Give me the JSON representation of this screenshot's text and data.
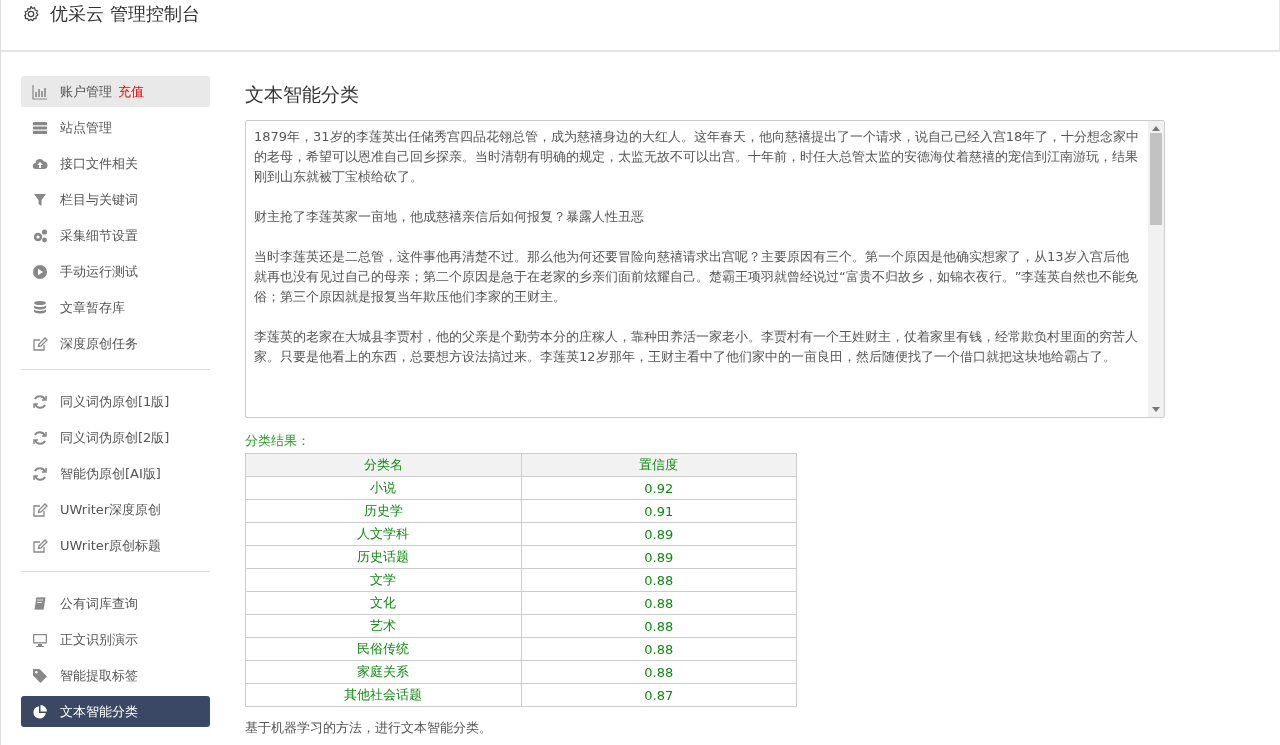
{
  "header": {
    "title": "优采云 管理控制台"
  },
  "sidebar": {
    "groups": [
      {
        "items": [
          {
            "label": "账户管理",
            "badge": "充值",
            "kind": "bars",
            "selected": false,
            "hover": true
          },
          {
            "label": "站点管理",
            "kind": "server",
            "selected": false,
            "hover": false
          },
          {
            "label": "接口文件相关",
            "kind": "cloud",
            "selected": false,
            "hover": false
          },
          {
            "label": "栏目与关键词",
            "kind": "filter",
            "selected": false,
            "hover": false
          },
          {
            "label": "采集细节设置",
            "kind": "gears",
            "selected": false,
            "hover": false
          },
          {
            "label": "手动运行测试",
            "kind": "play",
            "selected": false,
            "hover": false
          },
          {
            "label": "文章暂存库",
            "kind": "database",
            "selected": false,
            "hover": false
          },
          {
            "label": "深度原创任务",
            "kind": "edit",
            "selected": false,
            "hover": false
          }
        ]
      },
      {
        "items": [
          {
            "label": "同义词伪原创[1版]",
            "kind": "refresh",
            "selected": false,
            "hover": false
          },
          {
            "label": "同义词伪原创[2版]",
            "kind": "refresh",
            "selected": false,
            "hover": false
          },
          {
            "label": "智能伪原创[AI版]",
            "kind": "refresh",
            "selected": false,
            "hover": false
          },
          {
            "label": "UWriter深度原创",
            "kind": "edit",
            "selected": false,
            "hover": false
          },
          {
            "label": "UWriter原创标题",
            "kind": "edit",
            "selected": false,
            "hover": false
          }
        ]
      },
      {
        "items": [
          {
            "label": "公有词库查询",
            "kind": "book",
            "selected": false,
            "hover": false
          },
          {
            "label": "正文识别演示",
            "kind": "monitor",
            "selected": false,
            "hover": false
          },
          {
            "label": "智能提取标签",
            "kind": "tag",
            "selected": false,
            "hover": false
          },
          {
            "label": "文本智能分类",
            "kind": "pie",
            "selected": true,
            "hover": false
          }
        ]
      }
    ]
  },
  "main": {
    "title": "文本智能分类",
    "text_area": {
      "paragraphs": [
        "1879年，31岁的李莲英出任储秀宫四品花翎总管，成为慈禧身边的大红人。这年春天，他向慈禧提出了一个请求，说自己已经入宫18年了，十分想念家中的老母，希望可以恩准自己回乡探亲。当时清朝有明确的规定，太监无故不可以出宫。十年前，时任大总管太监的安德海仗着慈禧的宠信到江南游玩，结果刚到山东就被丁宝桢给砍了。",
        "财主抢了李莲英家一亩地，他成慈禧亲信后如何报复？暴露人性丑恶",
        "当时李莲英还是二总管，这件事他再清楚不过。那么他为何还要冒险向慈禧请求出宫呢？主要原因有三个。第一个原因是他确实想家了，从13岁入宫后他就再也没有见过自己的母亲；第二个原因是急于在老家的乡亲们面前炫耀自己。楚霸王项羽就曾经说过“富贵不归故乡，如锦衣夜行。”李莲英自然也不能免俗；第三个原因就是报复当年欺压他们李家的王财主。",
        "李莲英的老家在大城县李贾村，他的父亲是个勤劳本分的庄稼人，靠种田养活一家老小。李贾村有一个王姓财主，仗着家里有钱，经常欺负村里面的穷苦人家。只要是他看上的东西，总要想方设法搞过来。李莲英12岁那年，王财主看中了他们家中的一亩良田，然后随便找了一个借口就把这块地给霸占了。"
      ]
    },
    "result_label": "分类结果：",
    "table": {
      "columns": [
        "分类名",
        "置信度"
      ],
      "rows": [
        [
          "小说",
          "0.92"
        ],
        [
          "历史学",
          "0.91"
        ],
        [
          "人文学科",
          "0.89"
        ],
        [
          "历史话题",
          "0.89"
        ],
        [
          "文学",
          "0.88"
        ],
        [
          "文化",
          "0.88"
        ],
        [
          "艺术",
          "0.88"
        ],
        [
          "民俗传统",
          "0.88"
        ],
        [
          "家庭关系",
          "0.88"
        ],
        [
          "其他社会话题",
          "0.87"
        ]
      ]
    },
    "footer_note": "基于机器学习的方法，进行文本智能分类。"
  }
}
